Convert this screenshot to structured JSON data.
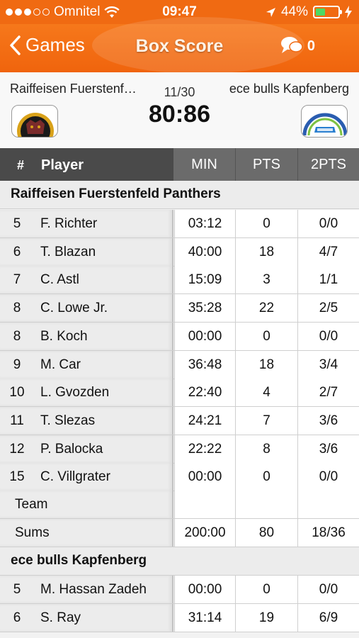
{
  "status_bar": {
    "carrier": "Omnitel",
    "time": "09:47",
    "battery": "44%",
    "battery_level": 0.44
  },
  "nav": {
    "back_label": "Games",
    "title": "Box Score",
    "comment_count": "0",
    "icons": {
      "back": "chevron-left-icon",
      "comments": "chat-bubbles-icon"
    }
  },
  "match": {
    "home_team": "Raiffeisen Fuerstenfeld Panthers",
    "away_team": "ece bulls Kapfenberg",
    "date": "11/30",
    "score": "80:86"
  },
  "table_header": {
    "hash": "#",
    "player": "Player",
    "columns": [
      "MIN",
      "PTS",
      "2PTS"
    ]
  },
  "home": {
    "team_label": "Raiffeisen Fuerstenfeld Panthers",
    "players": [
      {
        "num": "5",
        "name": "F. Richter",
        "min": "03:12",
        "pts": "0",
        "p2": "0/0"
      },
      {
        "num": "6",
        "name": "T. Blazan",
        "min": "40:00",
        "pts": "18",
        "p2": "4/7"
      },
      {
        "num": "7",
        "name": "C. Astl",
        "min": "15:09",
        "pts": "3",
        "p2": "1/1"
      },
      {
        "num": "8",
        "name": "C. Lowe Jr.",
        "min": "35:28",
        "pts": "22",
        "p2": "2/5"
      },
      {
        "num": "8",
        "name": "B. Koch",
        "min": "00:00",
        "pts": "0",
        "p2": "0/0"
      },
      {
        "num": "9",
        "name": "M. Car",
        "min": "36:48",
        "pts": "18",
        "p2": "3/4"
      },
      {
        "num": "10",
        "name": "L. Gvozden",
        "min": "22:40",
        "pts": "4",
        "p2": "2/7"
      },
      {
        "num": "11",
        "name": "T. Slezas",
        "min": "24:21",
        "pts": "7",
        "p2": "3/6"
      },
      {
        "num": "12",
        "name": "P. Balocka",
        "min": "22:22",
        "pts": "8",
        "p2": "3/6"
      },
      {
        "num": "15",
        "name": "C. Villgrater",
        "min": "00:00",
        "pts": "0",
        "p2": "0/0"
      }
    ],
    "team_row": {
      "label": "Team",
      "min": "",
      "pts": "",
      "p2": ""
    },
    "sums_row": {
      "label": "Sums",
      "min": "200:00",
      "pts": "80",
      "p2": "18/36"
    }
  },
  "away": {
    "team_label": "ece bulls Kapfenberg",
    "players": [
      {
        "num": "5",
        "name": "M. Hassan Zadeh",
        "min": "00:00",
        "pts": "0",
        "p2": "0/0"
      },
      {
        "num": "6",
        "name": "S. Ray",
        "min": "31:14",
        "pts": "19",
        "p2": "6/9"
      }
    ]
  },
  "colors": {
    "accent": "#f06a12",
    "header_dark": "#4a4a4a",
    "header_mid": "#6b6b6b"
  }
}
